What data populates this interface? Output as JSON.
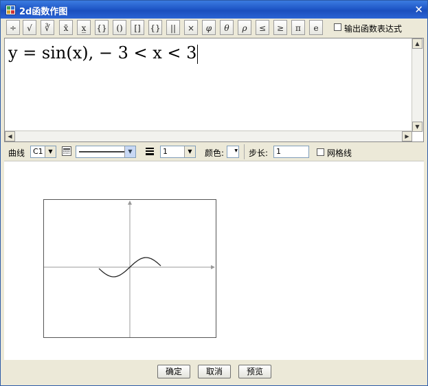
{
  "window": {
    "title": "2d函数作图",
    "close_glyph": "✕"
  },
  "toolbar": {
    "buttons": [
      "÷",
      "√",
      "∛",
      "x̄",
      "x̲",
      "{}",
      "()",
      "[]",
      "{}",
      "||",
      "×",
      "φ",
      "θ",
      "ρ",
      "≤",
      "≥",
      "π",
      "e"
    ],
    "output_expression_label": "输出函数表达式",
    "output_expression_checked": false
  },
  "editor": {
    "formula": "y = sin(x),  − 3 < x < 3"
  },
  "curve_props": {
    "curve_label": "曲线",
    "curve_value": "C1",
    "line_width_value": "1",
    "color_label": "颜色:",
    "step_label": "步长:",
    "step_value": "1",
    "grid_label": "网格线",
    "grid_checked": false
  },
  "chart_data": {
    "type": "line",
    "series": [
      {
        "expression": "y = sin(x)",
        "x_range": [
          -3,
          3
        ]
      }
    ],
    "grid": false
  },
  "footer": {
    "ok_label": "确定",
    "cancel_label": "取消",
    "preview_label": "预览"
  }
}
